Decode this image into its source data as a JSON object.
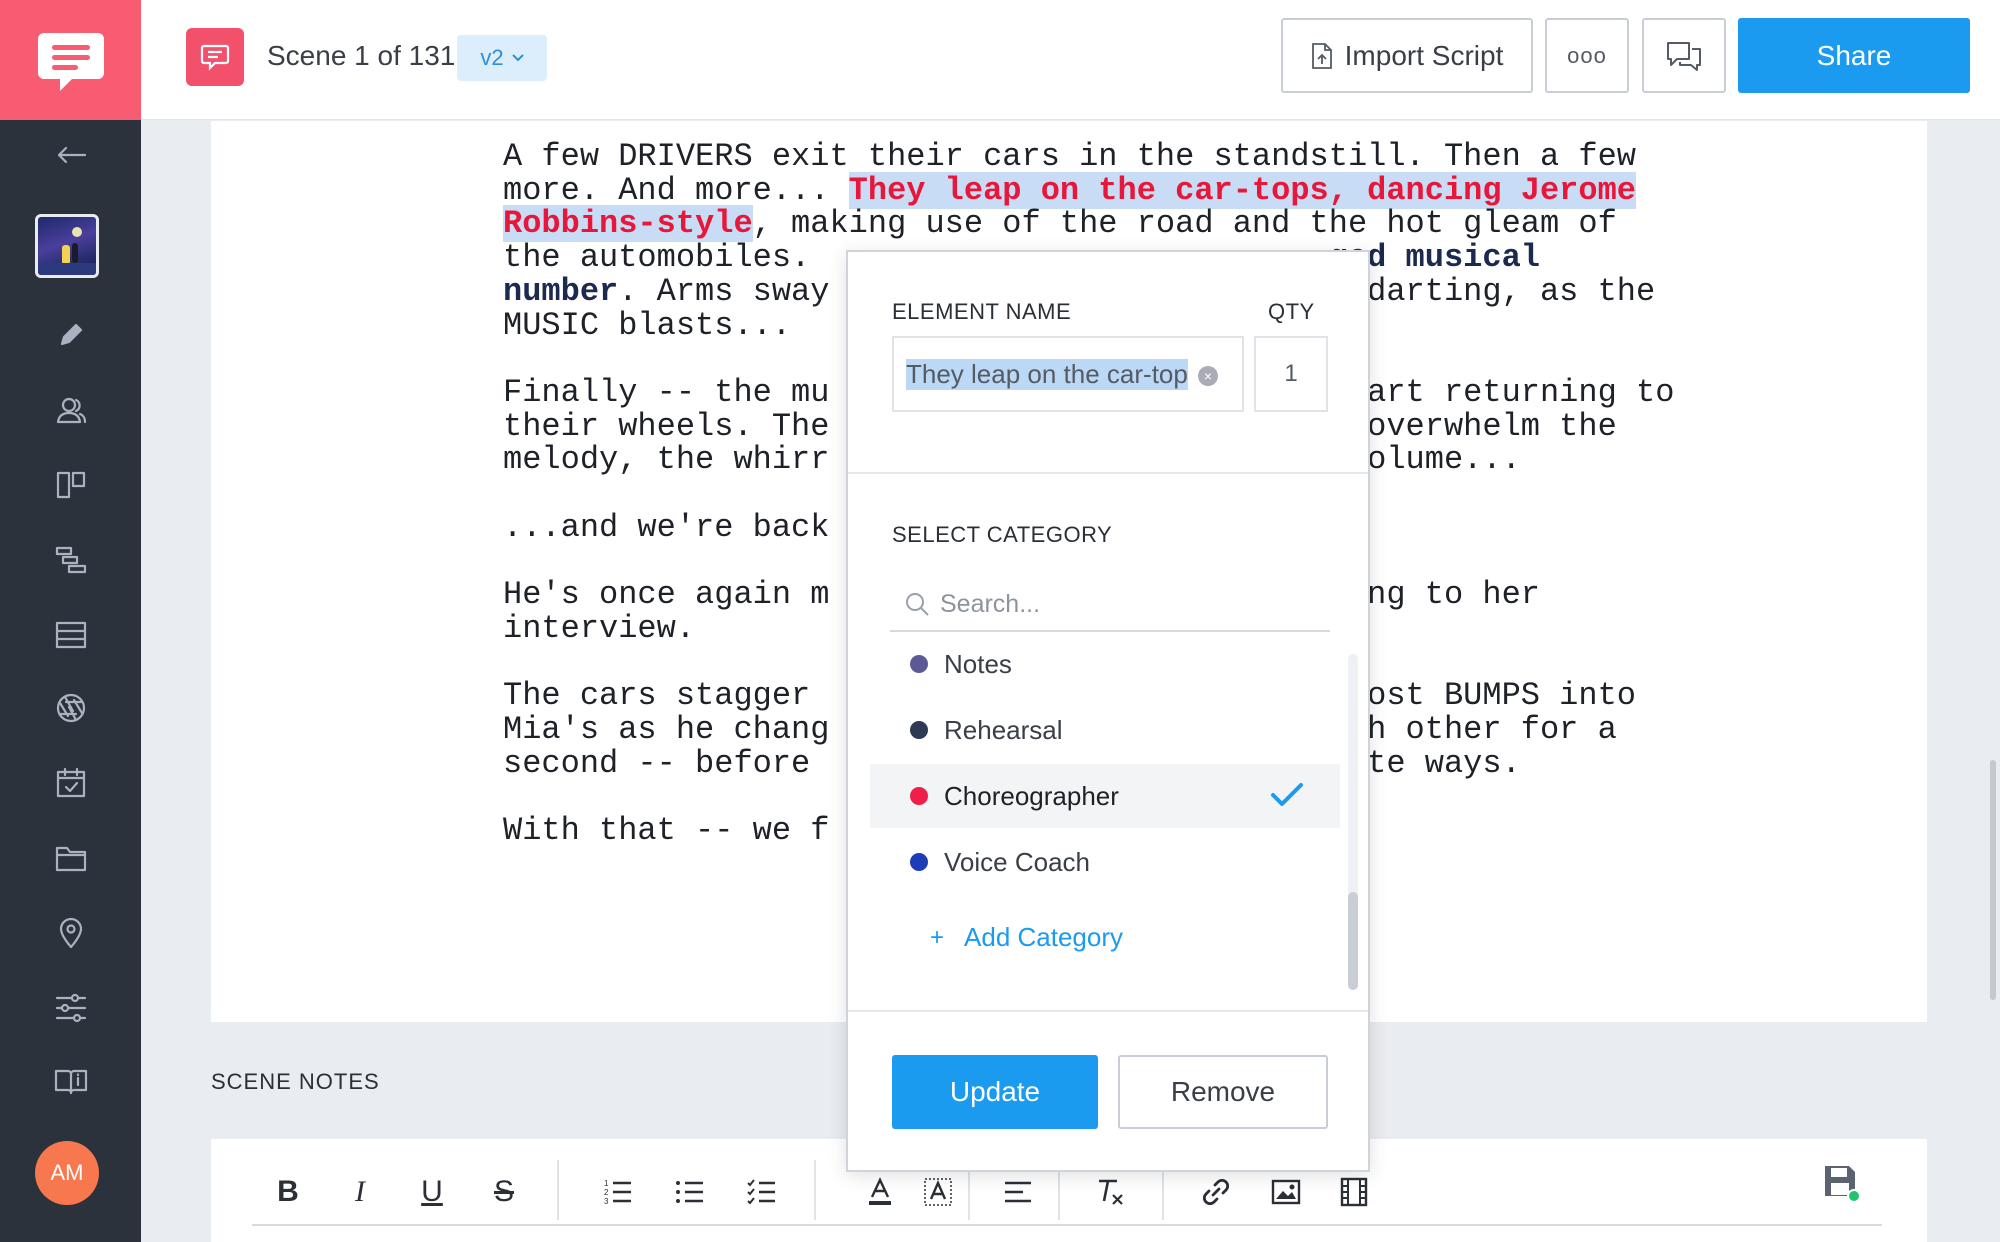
{
  "header": {
    "scene_label": "Scene 1 of 131",
    "version": "v2",
    "import_label": "Import Script",
    "more_label": "ooo",
    "share_label": "Share"
  },
  "sidebar": {
    "avatar_initials": "AM",
    "items": [
      "back",
      "project",
      "edit",
      "characters",
      "storyboard",
      "shot-list",
      "stripboard",
      "elements",
      "calendar",
      "files",
      "locations",
      "settings",
      "manual"
    ]
  },
  "script": {
    "lines": [
      [
        {
          "t": "A few DRIVERS exit their cars in the standstill. Then a few"
        }
      ],
      [
        {
          "t": "more. And more... "
        },
        {
          "t": "They leap on the car-tops, dancing Jerome",
          "s": "hl"
        }
      ],
      [
        {
          "t": "Robbins-style",
          "s": "hl"
        },
        {
          "t": ", making use of the road and the hot gleam of"
        }
      ],
      [
        {
          "t": "the automobiles.                           "
        },
        {
          "t": "ged musical",
          "s": "bold"
        }
      ],
      [
        {
          "t": "number",
          "s": "bold"
        },
        {
          "t": ". Arms sway                            darting, as the"
        }
      ],
      [
        {
          "t": "MUSIC blasts..."
        }
      ],
      [
        {
          "t": ""
        }
      ],
      [
        {
          "t": "Finally -- the mu                          start returning to"
        }
      ],
      [
        {
          "t": "their wheels. The                          s overwhelm the"
        }
      ],
      [
        {
          "t": "melody, the whirr                           volume..."
        }
      ],
      [
        {
          "t": ""
        }
      ],
      [
        {
          "t": "...and we're back"
        }
      ],
      [
        {
          "t": ""
        }
      ],
      [
        {
          "t": "He's once again m                          ning to her"
        }
      ],
      [
        {
          "t": "interview."
        }
      ],
      [
        {
          "t": ""
        }
      ],
      [
        {
          "t": "The cars stagger                           lmost BUMPS into"
        }
      ],
      [
        {
          "t": "Mia's as he chang                          ach other for a"
        }
      ],
      [
        {
          "t": "second -- before                           rate ways."
        }
      ],
      [
        {
          "t": ""
        }
      ],
      [
        {
          "t": "With that -- we f"
        }
      ]
    ]
  },
  "scene_notes": {
    "label": "SCENE NOTES",
    "toolbar": [
      "bold",
      "italic",
      "underline",
      "strikethrough",
      "numbered-list",
      "bullet-list",
      "checklist",
      "text-color",
      "highlight-color",
      "align",
      "clear-format",
      "link",
      "image",
      "film"
    ]
  },
  "modal": {
    "element_name_label": "ELEMENT NAME",
    "qty_label": "QTY",
    "element_name_value": "They leap on the car-tops, dancing Jerome Robbins-style",
    "element_name_visible": "They leap on the car-top",
    "qty_value": "1",
    "select_category_label": "SELECT CATEGORY",
    "search_placeholder": "Search...",
    "categories": [
      {
        "label": "Notes",
        "color": "#5b5a96",
        "selected": false
      },
      {
        "label": "Rehearsal",
        "color": "#2c3a55",
        "selected": false
      },
      {
        "label": "Choreographer",
        "color": "#ef1f4a",
        "selected": true
      },
      {
        "label": "Voice Coach",
        "color": "#1c3db5",
        "selected": false
      }
    ],
    "add_category_label": "Add Category",
    "update_label": "Update",
    "remove_label": "Remove"
  },
  "colors": {
    "accent": "#1a9bf0",
    "brand_pink": "#f75c73",
    "sidebar_bg": "#2c323c",
    "highlight_text": "#e8173a",
    "highlight_bg": "#c9dcf5"
  }
}
